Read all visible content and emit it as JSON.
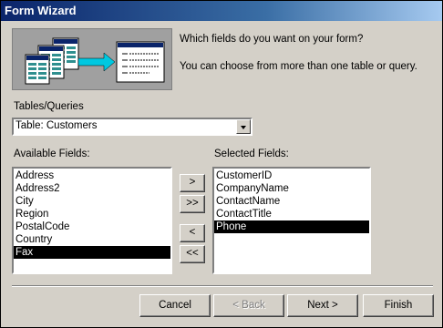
{
  "window": {
    "title": "Form Wizard"
  },
  "prompt": {
    "question": "Which fields do you want on your form?",
    "hint": "You can choose from more than one table or query."
  },
  "tables": {
    "label": "Tables/Queries",
    "selected": "Table: Customers"
  },
  "available": {
    "label": "Available Fields:",
    "items": [
      "Address",
      "Address2",
      "City",
      "Region",
      "PostalCode",
      "Country",
      "Fax"
    ],
    "selected_index": 6
  },
  "selected_fields": {
    "label": "Selected Fields:",
    "items": [
      "CustomerID",
      "CompanyName",
      "ContactName",
      "ContactTitle",
      "Phone"
    ],
    "selected_index": 4
  },
  "move_buttons": {
    "add_one": ">",
    "add_all": ">>",
    "remove_one": "<",
    "remove_all": "<<"
  },
  "footer": {
    "cancel": "Cancel",
    "back": "< Back",
    "next": "Next >",
    "finish": "Finish"
  }
}
